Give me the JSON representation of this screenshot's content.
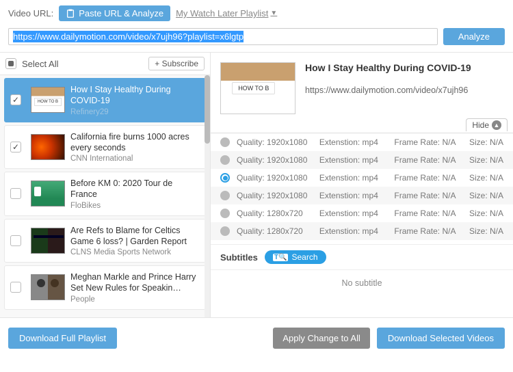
{
  "top": {
    "url_label": "Video URL:",
    "paste_label": "Paste URL & Analyze",
    "watch_later": "My Watch Later Playlist",
    "url_value": "https://www.dailymotion.com/video/x7ujh96?playlist=x6lgtp",
    "analyze": "Analyze"
  },
  "list_header": {
    "select_all": "Select All",
    "subscribe": "+ Subscribe"
  },
  "videos": [
    {
      "title": "How I Stay Healthy During COVID-19",
      "source": "Refinery29",
      "checked": true,
      "selected": true,
      "thumb": "howto"
    },
    {
      "title": "California fire burns 1000 acres every seconds",
      "source": "CNN International",
      "checked": true,
      "selected": false,
      "thumb": "fire"
    },
    {
      "title": "Before KM 0: 2020 Tour de France",
      "source": "FloBikes",
      "checked": false,
      "selected": false,
      "thumb": "tour"
    },
    {
      "title": "Are Refs to Blame for Celtics Game 6 loss? | Garden Report",
      "source": "CLNS Media Sports Network",
      "checked": false,
      "selected": false,
      "thumb": "celtics"
    },
    {
      "title": "Meghan Markle and Prince Harry Set New Rules for Speakin…",
      "source": "People",
      "checked": false,
      "selected": false,
      "thumb": "meghan"
    }
  ],
  "detail": {
    "title": "How I Stay Healthy During COVID-19",
    "url": "https://www.dailymotion.com/video/x7ujh96",
    "hide": "Hide"
  },
  "qualities": [
    {
      "res": "1920x1080",
      "ext": "mp4",
      "fr": "N/A",
      "size": "N/A",
      "sel": false
    },
    {
      "res": "1920x1080",
      "ext": "mp4",
      "fr": "N/A",
      "size": "N/A",
      "sel": false
    },
    {
      "res": "1920x1080",
      "ext": "mp4",
      "fr": "N/A",
      "size": "N/A",
      "sel": true
    },
    {
      "res": "1920x1080",
      "ext": "mp4",
      "fr": "N/A",
      "size": "N/A",
      "sel": false
    },
    {
      "res": "1280x720",
      "ext": "mp4",
      "fr": "N/A",
      "size": "N/A",
      "sel": false
    },
    {
      "res": "1280x720",
      "ext": "mp4",
      "fr": "N/A",
      "size": "N/A",
      "sel": false
    }
  ],
  "quality_labels": {
    "quality": "Quality:",
    "ext": "Extenstion:",
    "fr": "Frame Rate:",
    "size": "Size:"
  },
  "subtitles": {
    "label": "Subtitles",
    "search": "Search",
    "none": "No subtitle"
  },
  "bottom": {
    "download_playlist": "Download Full Playlist",
    "apply_all": "Apply Change to All",
    "download_selected": "Download Selected Videos"
  }
}
